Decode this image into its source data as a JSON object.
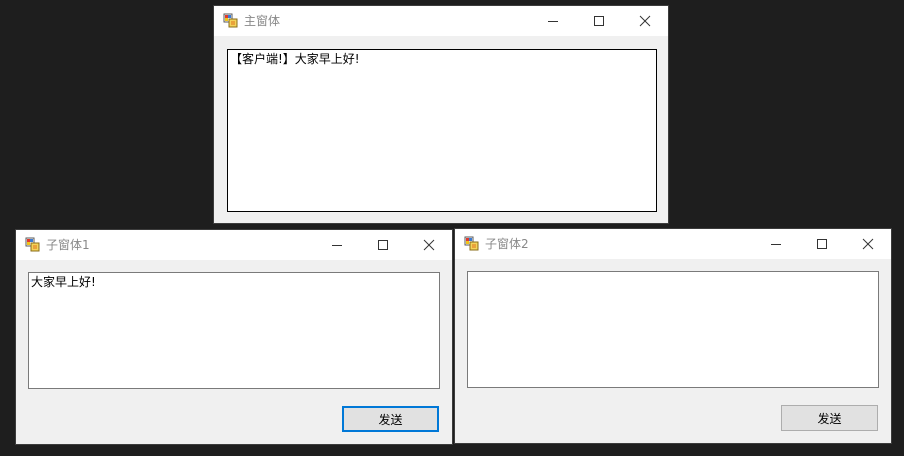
{
  "windows": {
    "main": {
      "title": "主窗体",
      "textbox_text": "【客户端!】大家早上好!"
    },
    "child1": {
      "title": "子窗体1",
      "textbox_text": "大家早上好!",
      "send_label": "发送"
    },
    "child2": {
      "title": "子窗体2",
      "textbox_text": "",
      "send_label": "发送"
    }
  },
  "colors": {
    "desktop_bg": "#1e1e1e",
    "window_bg": "#f0f0f0",
    "titlebar_bg": "#ffffff",
    "title_text": "#888888",
    "focus_accent": "#0078d7"
  }
}
